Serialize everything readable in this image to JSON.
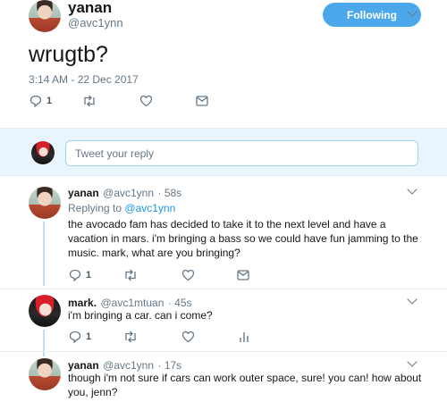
{
  "main_tweet": {
    "name": "yanan",
    "handle": "@avc1ynn",
    "follow_label": "Following",
    "text": "wrugtb?",
    "timestamp": "3:14 AM - 22 Dec 2017",
    "reply_count": "1"
  },
  "reply_box": {
    "placeholder": "Tweet your reply"
  },
  "thread": [
    {
      "name": "yanan",
      "handle": "@avc1ynn",
      "time": "· 58s",
      "replying_prefix": "Replying to",
      "replying_to": "@avc1ynn",
      "text": "the avocado fam has decided to take it to the next level and have a vacation in mars. i'm bringing a bass so we could have fun jamming to the music. mark, what are you bringing?",
      "reply_count": "1"
    },
    {
      "name": "mark.",
      "handle": "@avc1mtuan",
      "time": "· 45s",
      "text": "i'm bringing a car. can i come?",
      "reply_count": "1"
    },
    {
      "name": "yanan",
      "handle": "@avc1ynn",
      "time": "· 17s",
      "text": "though i'm not sure if cars can work outer space, sure! you can! how about you, jenn?"
    }
  ],
  "icons": [
    "reply-icon",
    "retweet-icon",
    "like-icon",
    "message-icon",
    "analytics-icon",
    "chevron-down-icon"
  ],
  "colors": {
    "accent": "#4ba8ea",
    "link": "#1b95e0",
    "secondary_text": "#657786",
    "reply_area_bg": "#e8f5fd",
    "thread_line": "#c4dcef"
  }
}
